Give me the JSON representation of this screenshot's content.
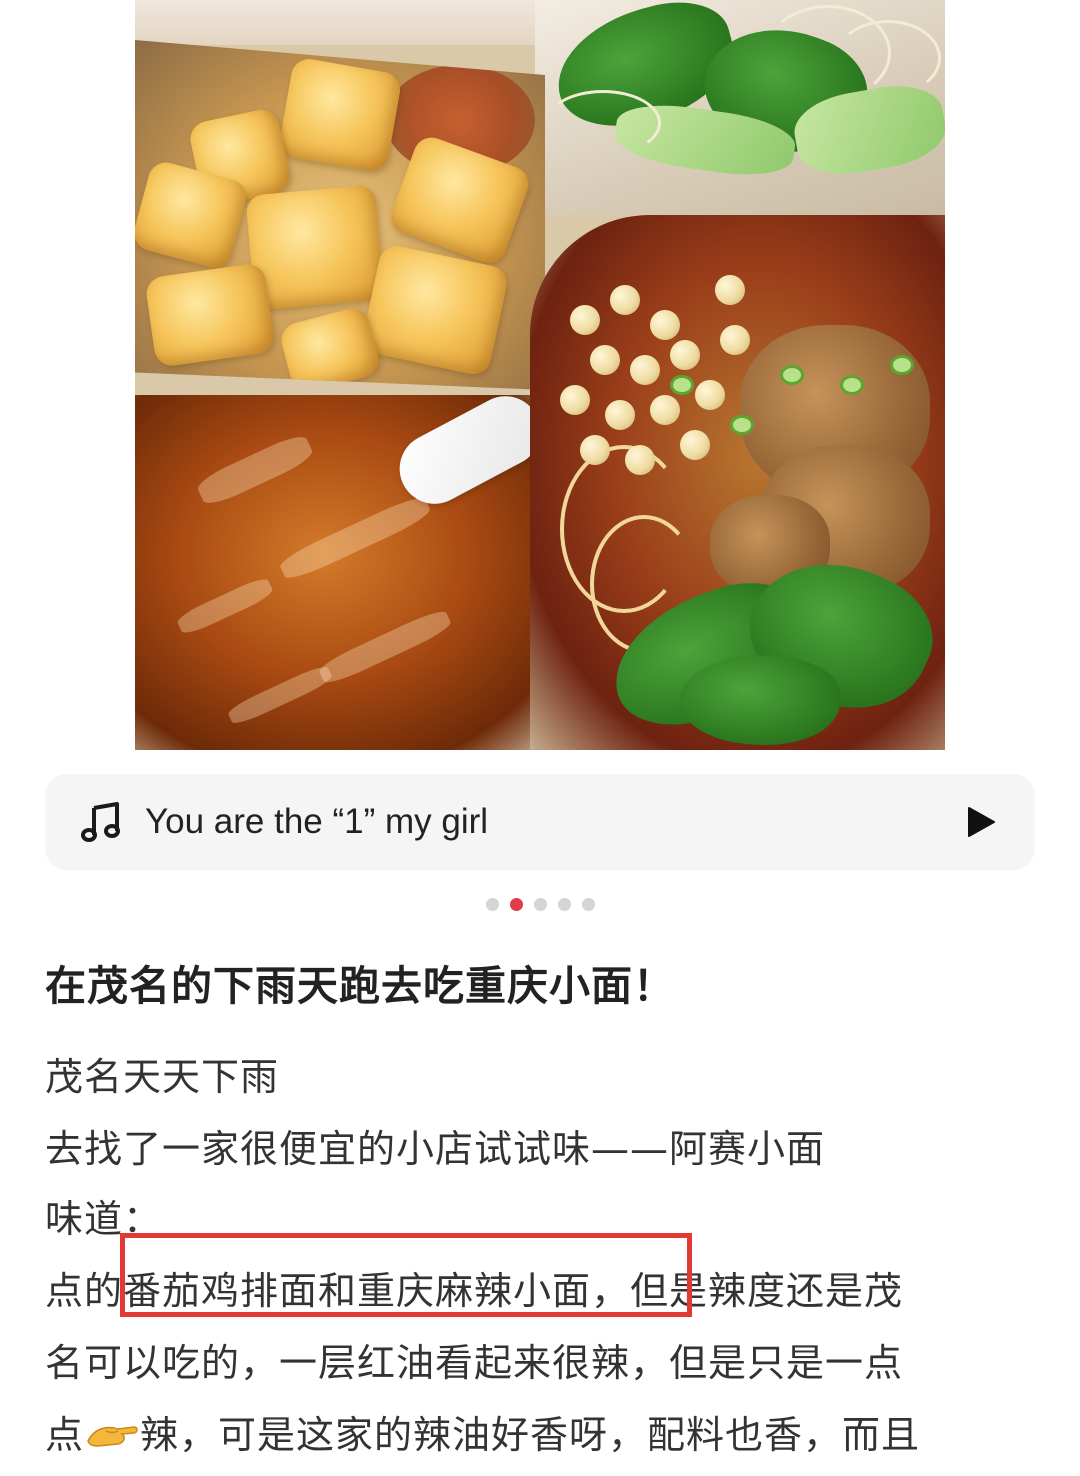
{
  "music": {
    "icon": "music-note-icon",
    "title": "You are the “1” my girl",
    "play_icon": "play-icon"
  },
  "carousel": {
    "total": 5,
    "active_index": 2
  },
  "post": {
    "title": "在茂名的下雨天跑去吃重庆小面！",
    "lines": {
      "l1": "茂名天天下雨",
      "l2": "去找了一家很便宜的小店试试味——阿赛小面",
      "l3": "味道：",
      "l4_pre": "点的",
      "l4_highlight": "番茄鸡排面和重庆麻辣小面，",
      "l4_post": "但是辣度还是茂",
      "l5": "名可以吃的，一层红油看起来很辣，但是只是一点",
      "l6_pre": "点",
      "l6_post": "辣，可是这家的辣油好香呀，配料也香，而且"
    },
    "emoji": "pinching-hand-icon"
  },
  "colors": {
    "highlight_border": "#e03a32",
    "active_dot": "#e23b48",
    "music_bg": "#f5f5f5"
  }
}
